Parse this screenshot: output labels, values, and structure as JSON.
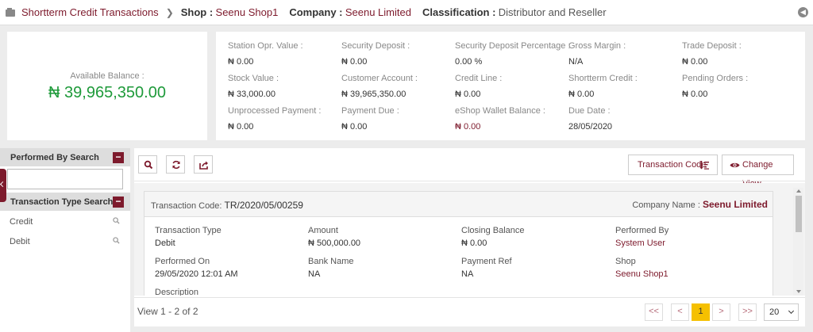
{
  "breadcrumb": {
    "root": "Shortterm Credit Transactions",
    "shop_label": "Shop :",
    "shop_value": "Seenu Shop1",
    "company_label": "Company :",
    "company_value": "Seenu Limited",
    "classification_label": "Classification :",
    "classification_value": "Distributor and Reseller"
  },
  "balance": {
    "label": "Available Balance :",
    "value": "₦ 39,965,350.00"
  },
  "stats": [
    {
      "label": "Station Opr. Value :",
      "value": "₦ 0.00"
    },
    {
      "label": "Security Deposit :",
      "value": "₦ 0.00"
    },
    {
      "label": "Security Deposit Percentage :",
      "value": "0.00 %"
    },
    {
      "label": "Gross Margin :",
      "value": "N/A"
    },
    {
      "label": "Trade Deposit :",
      "value": "₦ 0.00"
    },
    {
      "label": "Stock Value :",
      "value": "₦ 33,000.00"
    },
    {
      "label": "Customer Account :",
      "value": "₦ 39,965,350.00"
    },
    {
      "label": "Credit Line :",
      "value": "₦ 0.00"
    },
    {
      "label": "Shortterm Credit :",
      "value": "₦ 0.00"
    },
    {
      "label": "Pending Orders :",
      "value": "₦ 0.00"
    },
    {
      "label": "Unprocessed Payment :",
      "value": "₦ 0.00"
    },
    {
      "label": "Payment Due :",
      "value": "₦ 0.00"
    },
    {
      "label": "eShop Wallet Balance :",
      "value": "₦ 0.00"
    },
    {
      "label": "Due Date :",
      "value": "28/05/2020"
    }
  ],
  "sidebar": {
    "performed_by_title": "Performed By Search",
    "performed_by_value": "",
    "transaction_type_title": "Transaction Type Search",
    "types": [
      "Credit",
      "Debit"
    ]
  },
  "toolbar": {
    "transaction_code_label": "Transaction Code",
    "change_view_label": "Change View"
  },
  "transaction": {
    "code_label": "Transaction Code:",
    "code_value": "TR/2020/05/00259",
    "company_label": "Company Name :",
    "company_value": "Seenu Limited",
    "fields": [
      {
        "label": "Transaction Type",
        "value": "Debit"
      },
      {
        "label": "Amount",
        "value": "₦ 500,000.00"
      },
      {
        "label": "Closing Balance",
        "value": "₦ 0.00"
      },
      {
        "label": "Performed By",
        "value": "System User"
      },
      {
        "label": "Performed On",
        "value": "29/05/2020 12:01 AM"
      },
      {
        "label": "Bank Name",
        "value": "NA"
      },
      {
        "label": "Payment Ref",
        "value": "NA"
      },
      {
        "label": "Shop",
        "value": "Seenu Shop1"
      },
      {
        "label": "Description",
        "value": ""
      }
    ]
  },
  "pagination": {
    "summary": "View 1 - 2 of 2",
    "first": "<<",
    "prev": "<",
    "current": "1",
    "next": ">",
    "last": ">>",
    "page_size": "20"
  }
}
